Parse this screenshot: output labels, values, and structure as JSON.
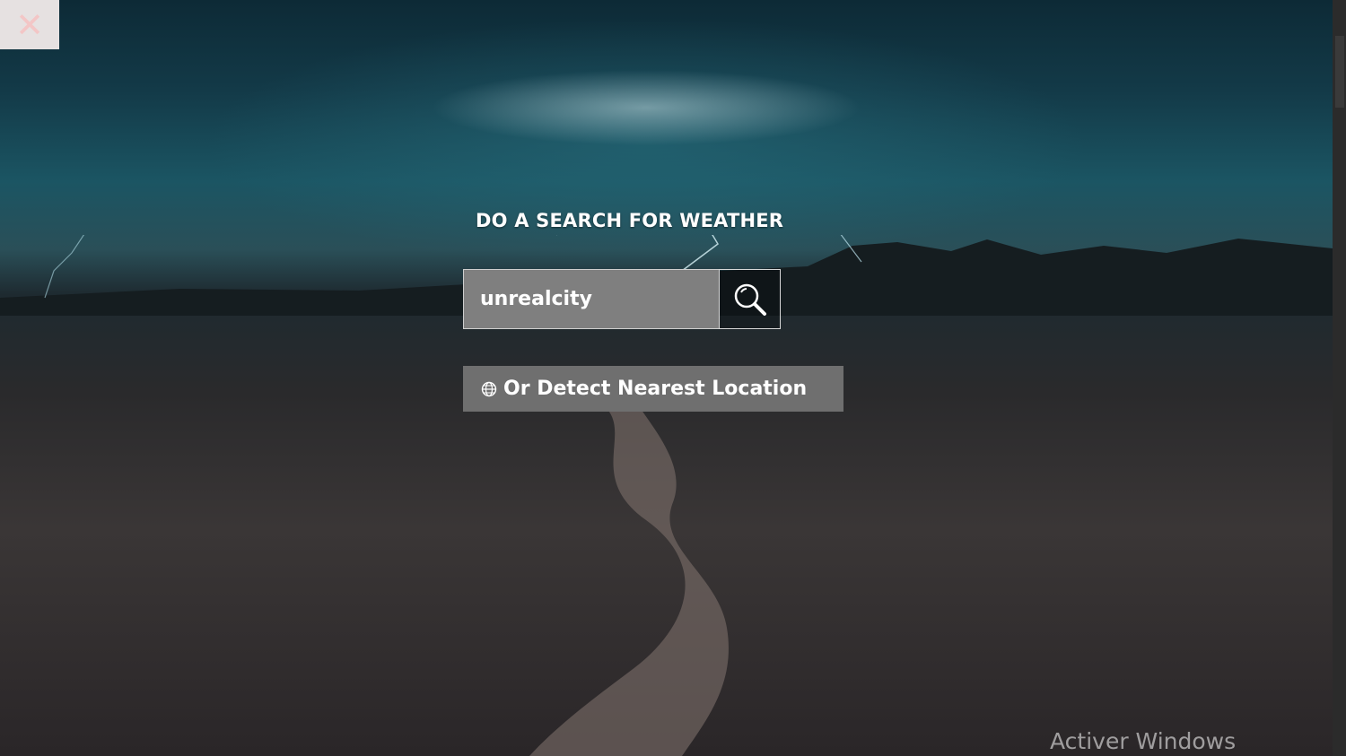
{
  "close": {
    "icon": "close-icon",
    "glyph": "✕"
  },
  "heading": {
    "text": "DO A SEARCH FOR WEATHER"
  },
  "search": {
    "value": "unrealcity",
    "icon": "search-icon"
  },
  "detect": {
    "label": "Or Detect Nearest Location",
    "icon": "globe-icon"
  },
  "watermark": {
    "text": "Activer Windows"
  },
  "colors": {
    "input_bg": "#7f7f7f",
    "button_bg": "#6f6f6f",
    "text": "#ffffff"
  }
}
